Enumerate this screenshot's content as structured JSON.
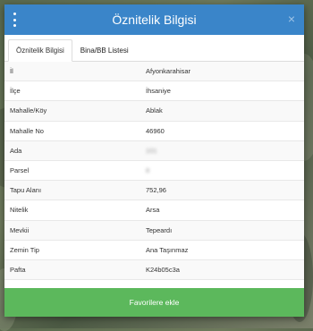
{
  "header": {
    "title": "Öznitelik Bilgisi",
    "close": "×"
  },
  "tabs": [
    {
      "label": "Öznitelik Bilgisi"
    },
    {
      "label": "Bina/BB Listesi"
    }
  ],
  "attributes": [
    {
      "key": "İl",
      "value": "Afyonkarahisar"
    },
    {
      "key": "İlçe",
      "value": "İhsaniye"
    },
    {
      "key": "Mahalle/Köy",
      "value": "Ablak"
    },
    {
      "key": "Mahalle No",
      "value": "46960"
    },
    {
      "key": "Ada",
      "value": "101"
    },
    {
      "key": "Parsel",
      "value": "8"
    },
    {
      "key": "Tapu Alanı",
      "value": "752,96"
    },
    {
      "key": "Nitelik",
      "value": "Arsa"
    },
    {
      "key": "Mevkii",
      "value": "Tepeardı"
    },
    {
      "key": "Zemin Tip",
      "value": "Ana Taşınmaz"
    },
    {
      "key": "Pafta",
      "value": "K24b05c3a"
    }
  ],
  "footer": {
    "button_label": "Favorilere ekle"
  },
  "colors": {
    "header": "#3a85c9",
    "button": "#5cb85c"
  }
}
